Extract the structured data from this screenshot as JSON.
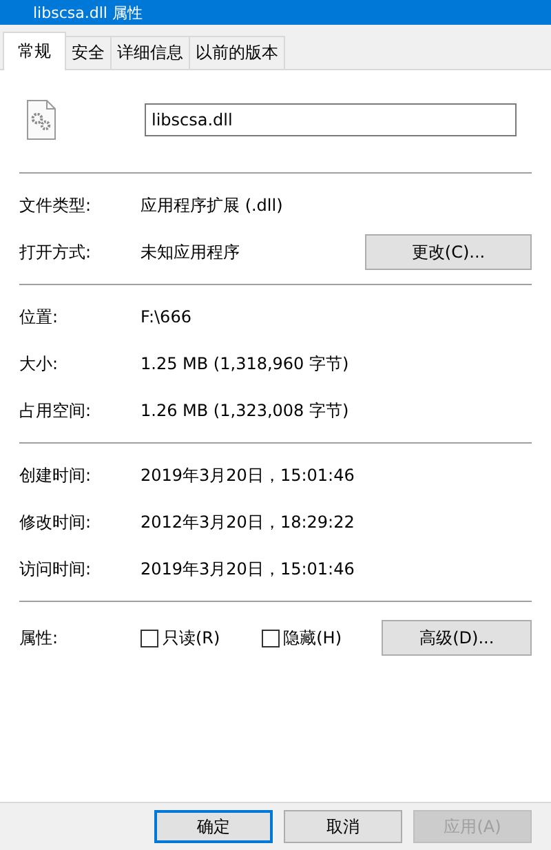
{
  "window": {
    "title": "libscsa.dll 属性"
  },
  "tabs": [
    {
      "label": "常规",
      "selected": true
    },
    {
      "label": "安全",
      "selected": false
    },
    {
      "label": "详细信息",
      "selected": false
    },
    {
      "label": "以前的版本",
      "selected": false
    }
  ],
  "file_name": {
    "value": "libscsa.dll"
  },
  "sections": [
    {
      "rows": [
        {
          "label": "文件类型:",
          "value": "应用程序扩展 (.dll)"
        },
        {
          "label": "打开方式:",
          "value": "未知应用程序",
          "button": "更改(C)..."
        }
      ]
    },
    {
      "rows": [
        {
          "label": "位置:",
          "value": "F:\\666"
        },
        {
          "label": "大小:",
          "value": "1.25 MB (1,318,960 字节)"
        },
        {
          "label": "占用空间:",
          "value": "1.26 MB (1,323,008 字节)"
        }
      ]
    },
    {
      "rows": [
        {
          "label": "创建时间:",
          "value": "2019年3月20日，15:01:46"
        },
        {
          "label": "修改时间:",
          "value": "2012年3月20日，18:29:22"
        },
        {
          "label": "访问时间:",
          "value": "2019年3月20日，15:01:46"
        }
      ]
    }
  ],
  "attributes": {
    "label": "属性:",
    "checkboxes": [
      {
        "label": "只读(R)",
        "checked": false
      },
      {
        "label": "隐藏(H)",
        "checked": false
      }
    ],
    "button": "高级(D)..."
  },
  "buttons": [
    {
      "label": "确定",
      "default": true,
      "disabled": false
    },
    {
      "label": "取消",
      "default": false,
      "disabled": false
    },
    {
      "label": "应用(A)",
      "default": false,
      "disabled": true
    }
  ]
}
